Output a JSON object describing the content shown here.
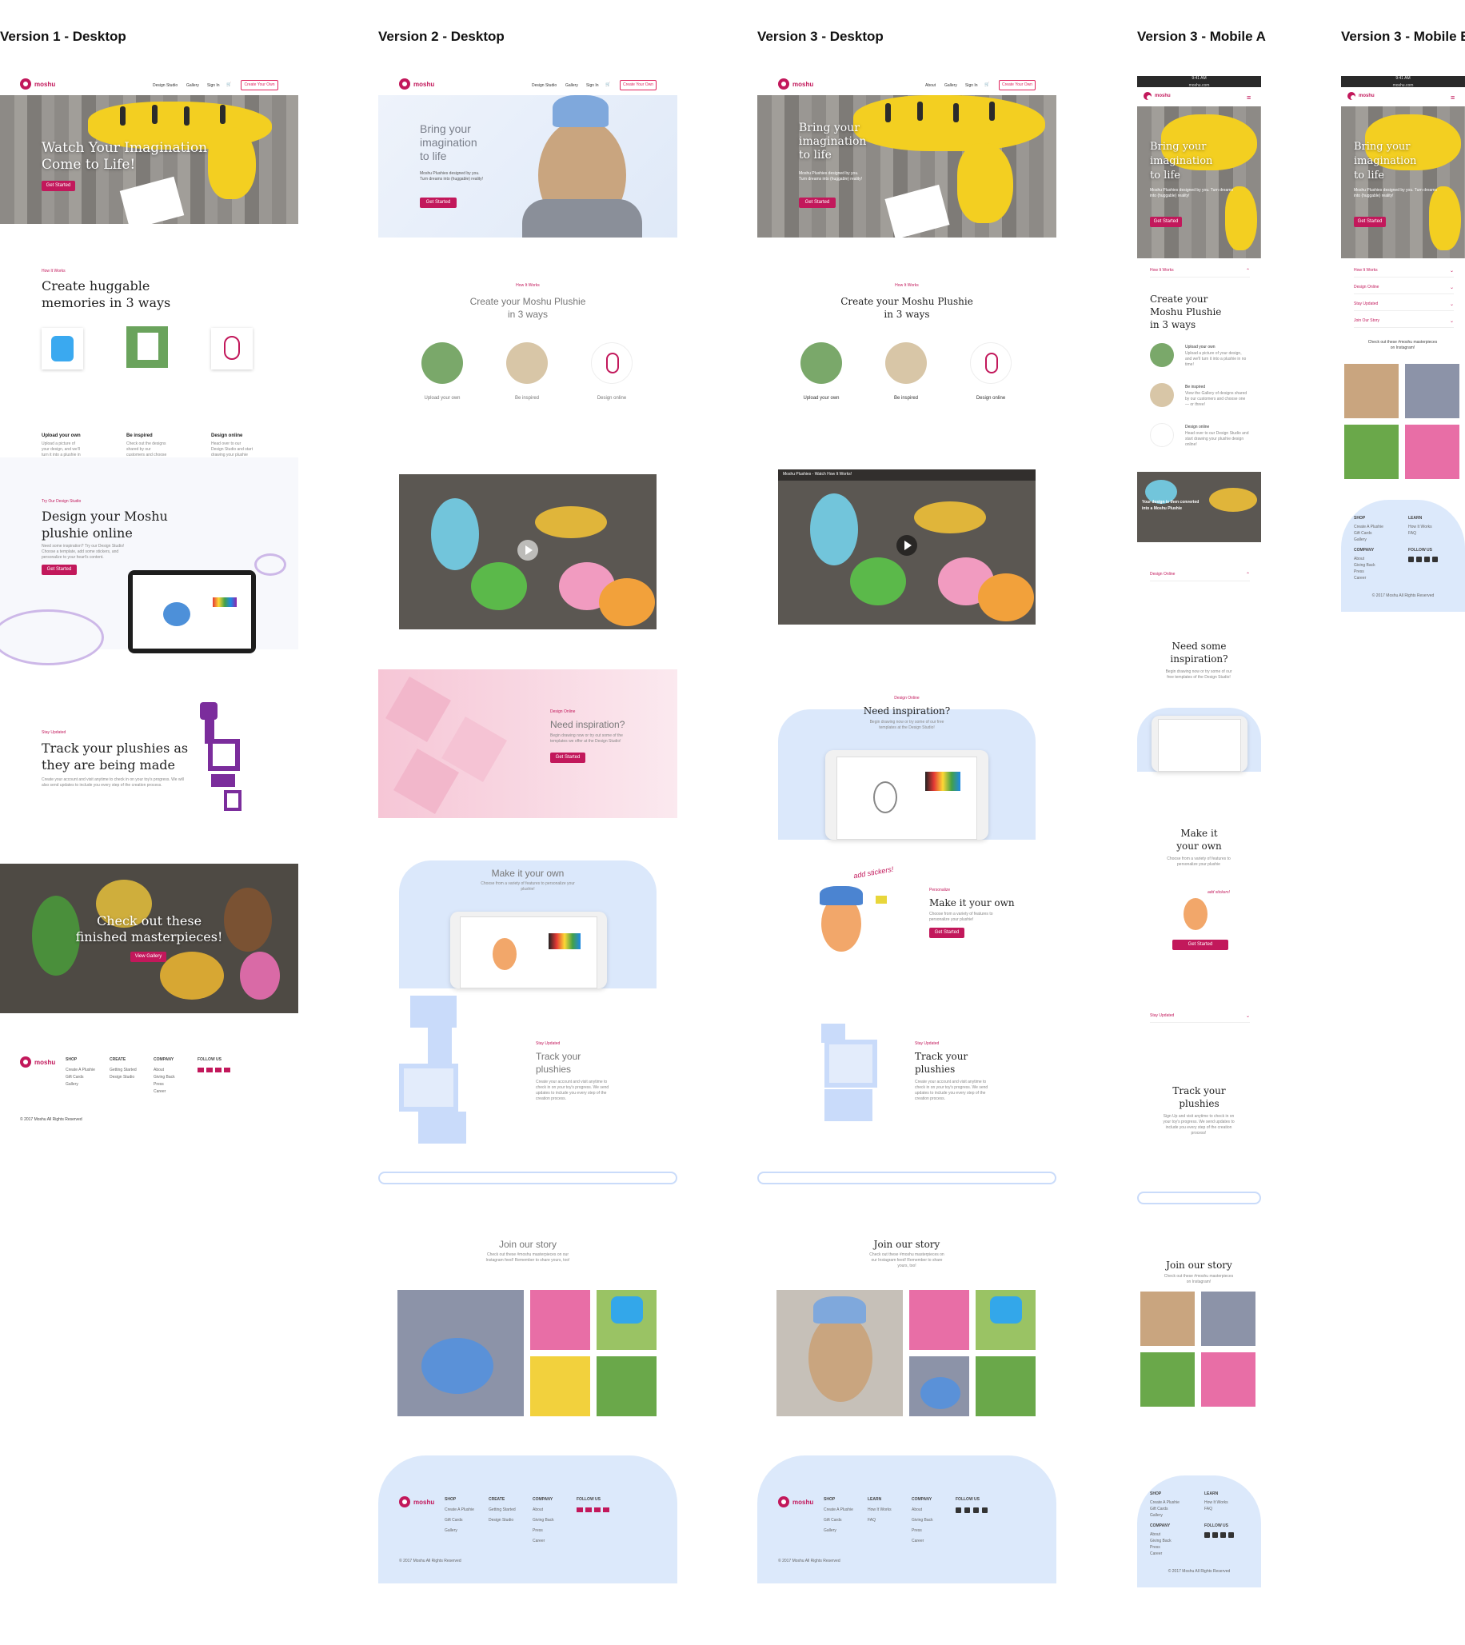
{
  "columns": [
    {
      "id": "v1",
      "title": "Version 1 - Desktop"
    },
    {
      "id": "v2",
      "title": "Version 2 - Desktop"
    },
    {
      "id": "v3",
      "title": "Version 3 - Desktop"
    },
    {
      "id": "v3ma",
      "title": "Version 3 - Mobile A"
    },
    {
      "id": "v3mb",
      "title": "Version 3 - Mobile B"
    }
  ],
  "brand": {
    "name": "moshu",
    "accent": "#c2185b",
    "light_blue": "#dbe8fb"
  },
  "v1": {
    "nav": [
      "Design Studio",
      "Gallery",
      "Sign In"
    ],
    "cta": "Create Your Own",
    "hero_line1": "Watch Your Imagination",
    "hero_line2": "Come to Life!",
    "hero_button": "Get Started",
    "how_tag": "How It Works",
    "how_title_1": "Create huggable",
    "how_title_2": "memories in 3 ways",
    "steps": [
      {
        "title": "Upload your own",
        "desc": "Upload a picture of your design, and we'll turn it into a plushie in no time!"
      },
      {
        "title": "Be inspired",
        "desc": "Check out the designs shared by our customers and choose one — or three!"
      },
      {
        "title": "Design online",
        "desc": "Head over to our Design Studio and start drawing your plushie design online!"
      }
    ],
    "studio_tag": "Try Our Design Studio",
    "studio_title_1": "Design your Moshu",
    "studio_title_2": "plushie online",
    "studio_desc": "Need some inspiration? Try our Design Studio! Choose a template, add some stickers, and personalize to your heart's content.",
    "studio_button": "Get Started",
    "track_tag": "Stay Updated",
    "track_title_1": "Track your plushies as",
    "track_title_2": "they are being made",
    "track_desc": "Create your account and visit anytime to check in on your toy's progress. We will also send updates to include you every step of the creation process.",
    "gallery_line1": "Check out these",
    "gallery_line2": "finished masterpieces!",
    "gallery_button": "View Gallery",
    "footer_cols": [
      {
        "head": "SHOP",
        "items": [
          "Create A Plushie",
          "Gift Cards",
          "Gallery"
        ]
      },
      {
        "head": "CREATE",
        "items": [
          "Getting Started",
          "Design Studio"
        ]
      },
      {
        "head": "COMPANY",
        "items": [
          "About",
          "Giving Back",
          "Press",
          "Career"
        ]
      },
      {
        "head": "FOLLOW US",
        "items": []
      }
    ],
    "copyright": "© 2017 Moshu All Rights Reserved"
  },
  "v2": {
    "nav": [
      "Design Studio",
      "Gallery",
      "Sign In"
    ],
    "cta": "Create Your Own",
    "hero_line1": "Bring your",
    "hero_line2": "imagination",
    "hero_line3": "to life",
    "hero_sub_1": "Moshu Plushies designed by you.",
    "hero_sub_2": "Turn dreams into (huggable) reality!",
    "hero_button": "Get Started",
    "how_tag": "How It Works",
    "how_title_1": "Create your Moshu Plushie",
    "how_title_2": "in 3 ways",
    "steps": [
      "Upload your own",
      "Be inspired",
      "Design online"
    ],
    "insp_tag": "Design Online",
    "insp_title": "Need inspiration?",
    "insp_desc": "Begin drawing now or try out some of the templates we offer at the Design Studio!",
    "insp_button": "Get Started",
    "make_title": "Make it your own",
    "make_desc": "Choose from a variety of features to personalize your plushie!",
    "track_tag": "Stay Updated",
    "track_title_1": "Track your",
    "track_title_2": "plushies",
    "track_desc": "Create your account and visit anytime to check in on your toy's progress. We send updates to include you every step of the creation process.",
    "join_title": "Join our story",
    "join_desc": "Check out these #moshu masterpieces on our Instagram feed! Remember to share yours, too!",
    "footer_cols": [
      {
        "head": "SHOP",
        "items": [
          "Create A Plushie",
          "Gift Cards",
          "Gallery"
        ]
      },
      {
        "head": "CREATE",
        "items": [
          "Getting Started",
          "Design Studio"
        ]
      },
      {
        "head": "COMPANY",
        "items": [
          "About",
          "Giving Back",
          "Press",
          "Career"
        ]
      },
      {
        "head": "FOLLOW US",
        "items": []
      }
    ],
    "copyright": "© 2017 Moshu All Rights Reserved"
  },
  "v3": {
    "nav": [
      "About",
      "Gallery",
      "Sign In"
    ],
    "cta": "Create Your Own",
    "hero_line1": "Bring your",
    "hero_line2": "imagination",
    "hero_line3": "to life",
    "hero_sub_1": "Moshu Plushies designed by you.",
    "hero_sub_2": "Turn dreams into (huggable) reality!",
    "hero_button": "Get Started",
    "how_tag": "How It Works",
    "how_title_1": "Create your Moshu Plushie",
    "how_title_2": "in 3 ways",
    "steps": [
      "Upload your own",
      "Be inspired",
      "Design online"
    ],
    "video_title": "Moshu Plushies - Watch How It Works!",
    "insp_tag": "Design Online",
    "insp_title": "Need inspiration?",
    "insp_desc": "Begin drawing now or try some of our free templates at the Design Studio!",
    "sticker_note": "add stickers!",
    "make_tag": "Personalize",
    "make_title": "Make it your own",
    "make_desc": "Choose from a variety of features to personalize your plushie!",
    "make_button": "Get Started",
    "track_tag": "Stay Updated",
    "track_title_1": "Track your",
    "track_title_2": "plushies",
    "track_desc": "Create your account and visit anytime to check in on your toy's progress. We send updates to include you every step of the creation process.",
    "join_title": "Join our story",
    "join_desc": "Check out these #moshu masterpieces on our Instagram feed! Remember to share yours, too!",
    "footer_cols": [
      {
        "head": "SHOP",
        "items": [
          "Create A Plushie",
          "Gift Cards",
          "Gallery"
        ]
      },
      {
        "head": "LEARN",
        "items": [
          "How It Works",
          "FAQ"
        ]
      },
      {
        "head": "COMPANY",
        "items": [
          "About",
          "Giving Back",
          "Press",
          "Career"
        ]
      },
      {
        "head": "FOLLOW US",
        "items": []
      }
    ],
    "copyright": "© 2017 Moshu All Rights Reserved"
  },
  "v3ma": {
    "status": "9:41 AM",
    "url": "moshu.com",
    "hero_line1": "Bring your",
    "hero_line2": "imagination",
    "hero_line3": "to life",
    "hero_sub": "Moshu Plushies designed by you. Turn dreams into (huggable) reality!",
    "hero_button": "Get Started",
    "acc_how": "How It Works",
    "how_title_1": "Create your",
    "how_title_2": "Moshu Plushie",
    "how_title_3": "in 3 ways",
    "steps": [
      {
        "title": "Upload your own",
        "desc": "Upload a picture of your design, and we'll turn it into a plushie in no time!"
      },
      {
        "title": "Be inspired",
        "desc": "View the Gallery of designs shared by our customers and choose one — or three!"
      },
      {
        "title": "Design online",
        "desc": "Head over to our Design Studio and start drawing your plushie design online!"
      }
    ],
    "video_caption_1": "Your design is then converted",
    "video_caption_2": "into a Moshu Plushie",
    "acc_design": "Design Online",
    "insp_title_1": "Need some",
    "insp_title_2": "inspiration?",
    "insp_desc": "Begin drawing now or try some of our free templates of the Design Studio!",
    "make_title_1": "Make it",
    "make_title_2": "your own",
    "make_desc": "Choose from a variety of features to personalize your plushie",
    "sticker_note": "add stickers!",
    "make_button": "Get Started",
    "acc_stay": "Stay Updated",
    "track_title_1": "Track your",
    "track_title_2": "plushies",
    "track_desc": "Sign Up and visit anytime to check in on your toy's progress. We send updates to include you every step of the creation process!",
    "join_title": "Join our story",
    "join_desc": "Check out these #moshu masterpieces on Instagram!",
    "footer_cols": [
      {
        "head": "SHOP",
        "items": [
          "Create A Plushie",
          "Gift Cards",
          "Gallery"
        ]
      },
      {
        "head": "LEARN",
        "items": [
          "How It Works",
          "FAQ"
        ]
      },
      {
        "head": "COMPANY",
        "items": [
          "About",
          "Giving Back",
          "Press",
          "Career"
        ]
      },
      {
        "head": "FOLLOW US",
        "items": []
      }
    ],
    "copyright": "© 2017 Moshu All Rights Reserved"
  },
  "v3mb": {
    "status": "9:41 AM",
    "url": "moshu.com",
    "hero_line1": "Bring your",
    "hero_line2": "imagination",
    "hero_line3": "to life",
    "hero_sub": "Moshu Plushies designed by you. Turn dreams into (huggable) reality!",
    "hero_button": "Get Started",
    "acc": [
      "How It Works",
      "Design Online",
      "Stay Updated",
      "Join Our Story"
    ],
    "insta": "Check out these #moshu masterpieces on Instagram!",
    "footer_cols": [
      {
        "head": "SHOP",
        "items": [
          "Create A Plushie",
          "Gift Cards",
          "Gallery"
        ]
      },
      {
        "head": "LEARN",
        "items": [
          "How It Works",
          "FAQ"
        ]
      },
      {
        "head": "COMPANY",
        "items": [
          "About",
          "Giving Back",
          "Press",
          "Career"
        ]
      },
      {
        "head": "FOLLOW US",
        "items": []
      }
    ],
    "copyright": "© 2017 Moshu All Rights Reserved"
  }
}
